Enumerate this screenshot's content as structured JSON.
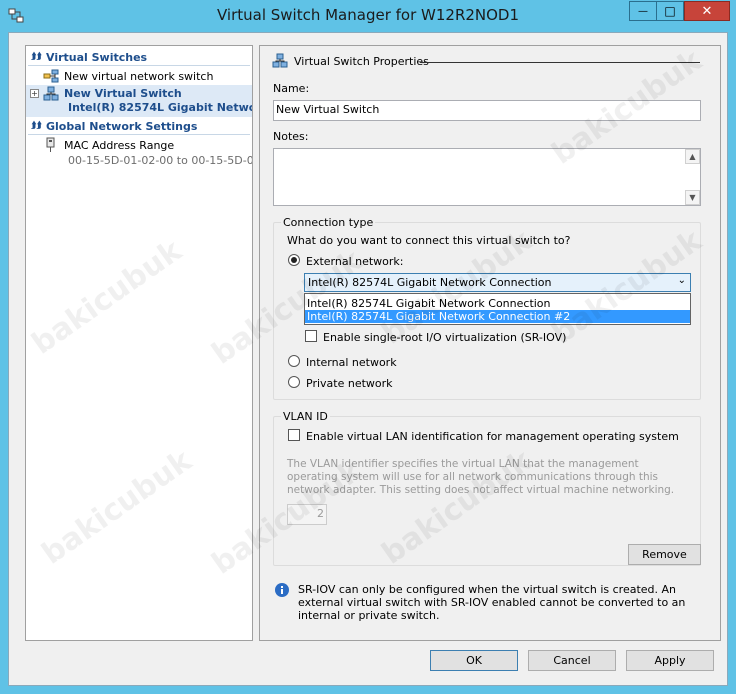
{
  "window": {
    "title": "Virtual Switch Manager for W12R2NOD1",
    "minimize": "—",
    "maximize": "□",
    "close": "✕"
  },
  "left": {
    "virtual_switches_header": "Virtual Switches",
    "new_switch_item": "New virtual network switch",
    "switch_name": "New Virtual Switch",
    "switch_adapter": "Intel(R) 82574L Gigabit Netwo...",
    "global_header": "Global Network Settings",
    "mac_label": "MAC Address Range",
    "mac_value": "00-15-5D-01-02-00 to 00-15-5D-0..."
  },
  "props": {
    "section_title": "Virtual Switch Properties",
    "name_label": "Name:",
    "name_value": "New Virtual Switch",
    "notes_label": "Notes:",
    "notes_value": ""
  },
  "connection": {
    "title": "Connection type",
    "question": "What do you want to connect this virtual switch to?",
    "external_label": "External network:",
    "external_selected": true,
    "combo_value": "Intel(R) 82574L Gigabit Network Connection",
    "options": [
      "Intel(R) 82574L Gigabit Network Connection",
      "Intel(R) 82574L Gigabit Network Connection #2"
    ],
    "sriov_label": "Enable single-root I/O virtualization (SR-IOV)",
    "internal_label": "Internal network",
    "private_label": "Private network"
  },
  "vlan": {
    "title": "VLAN ID",
    "enable_label": "Enable virtual LAN identification for management operating system",
    "description": "The VLAN identifier specifies the virtual LAN that the management operating system will use for all network communications through this network adapter. This setting does not affect virtual machine networking.",
    "value": "2"
  },
  "remove_label": "Remove",
  "info_text": "SR-IOV can only be configured when the virtual switch is created. An external virtual switch with SR-IOV enabled cannot be converted to an internal or private switch.",
  "buttons": {
    "ok": "OK",
    "cancel": "Cancel",
    "apply": "Apply"
  },
  "watermark_text": "bakicubuk",
  "colors": {
    "frame": "#5fc2e6",
    "accent": "#1e4e8c",
    "highlight": "#3399ff",
    "close": "#c7443a"
  }
}
